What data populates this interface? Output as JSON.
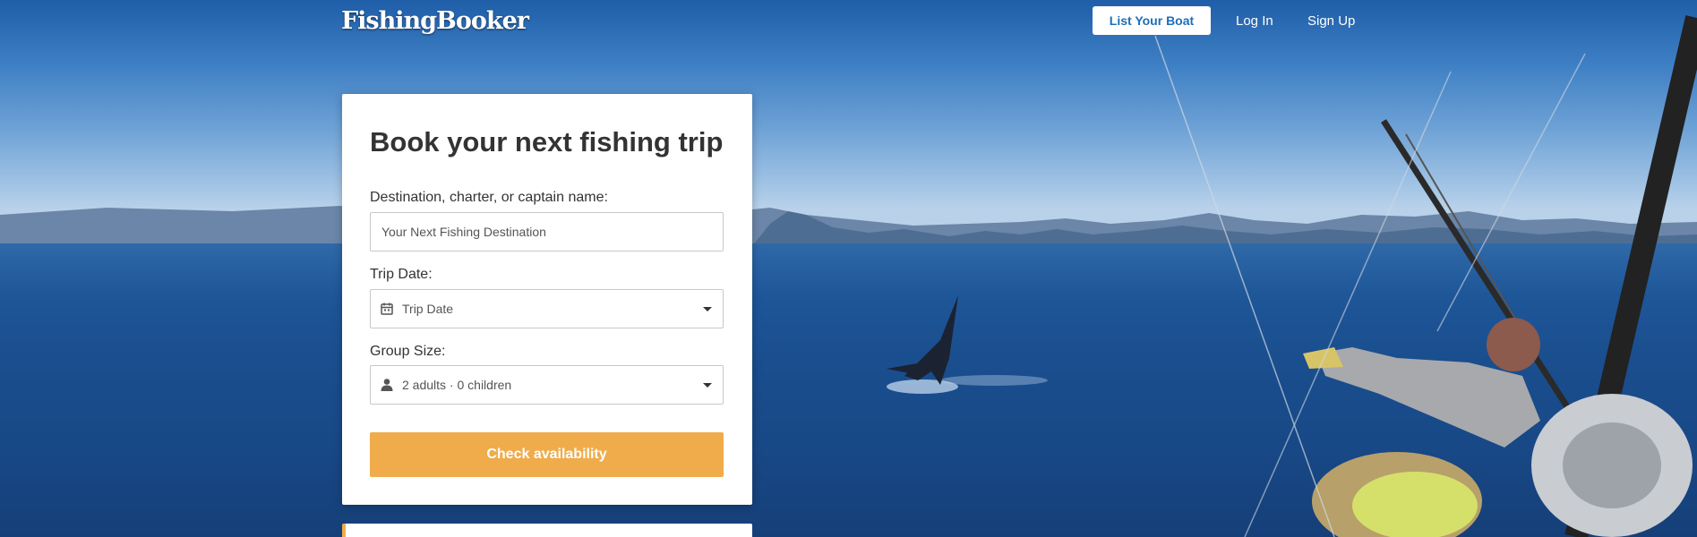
{
  "header": {
    "logo": "FishingBooker",
    "list_boat": "List Your Boat",
    "login": "Log In",
    "signup": "Sign Up"
  },
  "search": {
    "title": "Book your next fishing trip",
    "destination_label": "Destination, charter, or captain name:",
    "destination_placeholder": "Your Next Fishing Destination",
    "date_label": "Trip Date:",
    "date_value": "Trip Date",
    "group_label": "Group Size:",
    "group_value": "2 adults · 0 children",
    "cta": "Check availability"
  },
  "icons": {
    "date": "calendar-icon",
    "group": "person-icon",
    "dropdown": "caret-down-icon"
  },
  "colors": {
    "accent": "#f0ac4b",
    "link": "#1d6fb8"
  }
}
